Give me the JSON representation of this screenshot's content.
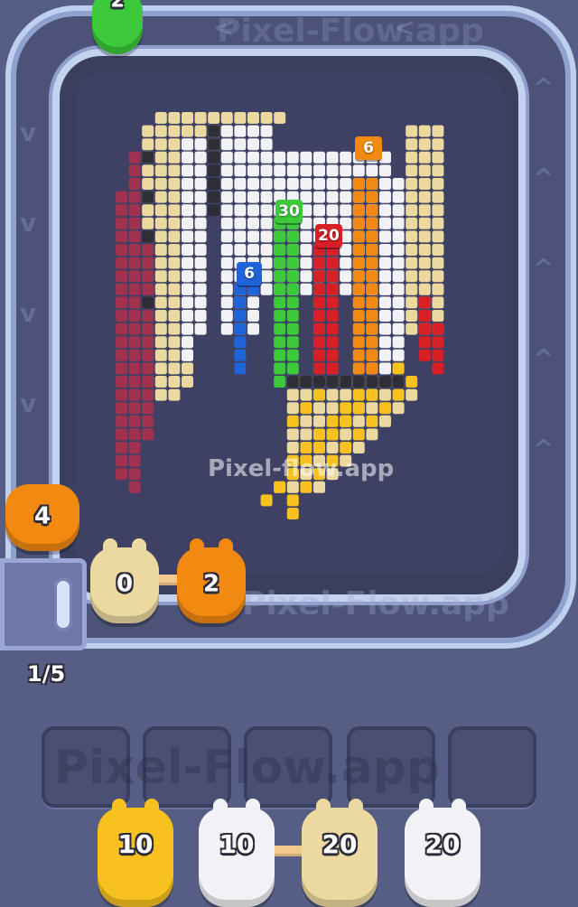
{
  "game": {
    "watermark_board": "Pixel-flow.app",
    "watermark_track": "Pixel-Flow.app",
    "watermark_slots": "Pixel-Flow.app",
    "queue_counter": "1/5"
  },
  "colors": {
    "background": "#575e86",
    "beige": "#ecd9a0",
    "white": "#f2f2f6",
    "maroon": "#a0314f",
    "orange": "#f28a12",
    "red": "#d81f25",
    "green": "#3cc93a",
    "blue": "#1f63d8",
    "yellow": "#f7c21f",
    "black": "#2e2f36"
  },
  "column_tags": [
    {
      "label": "30",
      "color": "green"
    },
    {
      "label": "20",
      "color": "red"
    },
    {
      "label": "6",
      "color": "blue"
    },
    {
      "label": "6",
      "color": "orange"
    }
  ],
  "track_critters": [
    {
      "label": "2",
      "color": "green"
    },
    {
      "label": "4",
      "color": "orange"
    },
    {
      "label": "0",
      "color": "beige"
    },
    {
      "label": "2",
      "color": "orange"
    }
  ],
  "waiting_slots": [
    "",
    "",
    "",
    "",
    ""
  ],
  "bench_critters": [
    {
      "label": "10",
      "color": "yellow"
    },
    {
      "label": "10",
      "color": "white"
    },
    {
      "label": "20",
      "color": "beige"
    },
    {
      "label": "20",
      "color": "white"
    }
  ]
}
